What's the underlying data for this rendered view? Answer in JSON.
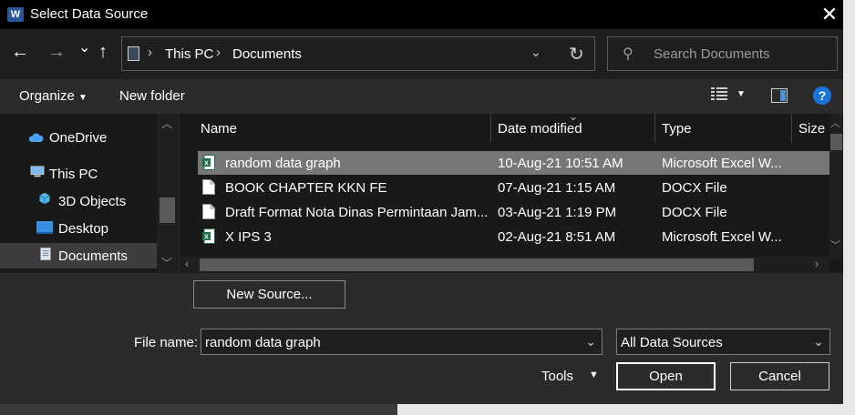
{
  "window": {
    "title": "Select Data Source",
    "app_icon": "W"
  },
  "nav": {
    "back": "←",
    "forward": "→",
    "recent": "⌄",
    "up": "↑",
    "breadcrumbs": [
      "This PC",
      "Documents"
    ],
    "search_placeholder": "Search Documents"
  },
  "toolbar": {
    "organize": "Organize",
    "new_folder": "New folder",
    "help": "?"
  },
  "sidebar": {
    "items": [
      {
        "label": "OneDrive",
        "icon": "cloud-icon"
      },
      {
        "label": "This PC",
        "icon": "computer-icon"
      },
      {
        "label": "3D Objects",
        "icon": "cube-icon"
      },
      {
        "label": "Desktop",
        "icon": "desktop-icon"
      },
      {
        "label": "Documents",
        "icon": "documents-icon",
        "selected": true
      }
    ]
  },
  "files": {
    "columns": [
      "Name",
      "Date modified",
      "Type",
      "Size"
    ],
    "rows": [
      {
        "name": "random data graph",
        "date": "10-Aug-21 10:51 AM",
        "type": "Microsoft Excel W...",
        "icon": "excel-file-icon",
        "selected": true
      },
      {
        "name": "BOOK CHAPTER KKN FE",
        "date": "07-Aug-21 1:15 AM",
        "type": "DOCX File",
        "icon": "document-file-icon"
      },
      {
        "name": "Draft Format Nota Dinas Permintaan Jam...",
        "date": "03-Aug-21 1:19 PM",
        "type": "DOCX File",
        "icon": "document-file-icon"
      },
      {
        "name": "X IPS 3",
        "date": "02-Aug-21 8:51 AM",
        "type": "Microsoft Excel W...",
        "icon": "excel-file-icon"
      }
    ]
  },
  "bottom": {
    "new_source": "New Source...",
    "file_name_label": "File name:",
    "file_name_value": "random data graph",
    "file_type_value": "All Data Sources",
    "tools": "Tools",
    "open": "Open",
    "cancel": "Cancel"
  },
  "colors": {
    "accent": "#1a73d9",
    "excel": "#1e7145",
    "word": "#2b579a"
  }
}
